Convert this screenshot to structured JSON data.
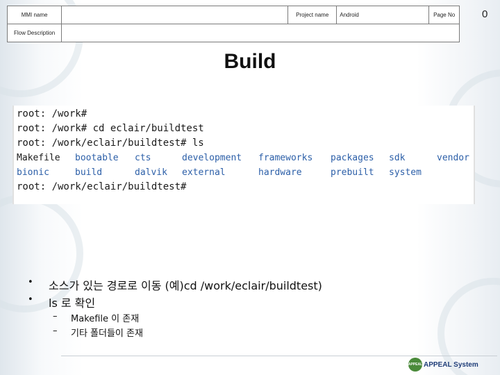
{
  "header": {
    "mmi_name_label": "MMI name",
    "project_name_label": "Project name",
    "project_name_value": "Android",
    "page_no_label": "Page No",
    "page_no_value": "0",
    "flow_description_label": "Flow Description"
  },
  "title": "Build",
  "terminal": {
    "lines": [
      "root: /work#",
      "root: /work# cd eclair/buildtest",
      "root: /work/eclair/buildtest# ls"
    ],
    "ls_row1": [
      "Makefile",
      "bootable",
      "cts",
      "development",
      "frameworks",
      "packages",
      "sdk",
      "vendor"
    ],
    "ls_row2": [
      "bionic",
      "build",
      "dalvik",
      "external",
      "hardware",
      "prebuilt",
      "system"
    ],
    "last_line": "root: /work/eclair/buildtest#"
  },
  "bullets": [
    {
      "text": "소스가 있는 경로로 이동 (예)cd /work/eclair/buildtest)",
      "subs": []
    },
    {
      "text": "ls 로 확인",
      "subs": [
        "Makefile 이 존재",
        "기타 폴더들이 존재"
      ]
    }
  ],
  "footer": {
    "logo_badge": "APPEAL",
    "logo_text": "APPEAL System"
  },
  "colors": {
    "directory": "#2c5fa8",
    "file": "#1a1a1a",
    "brand": "#1e3c78"
  }
}
